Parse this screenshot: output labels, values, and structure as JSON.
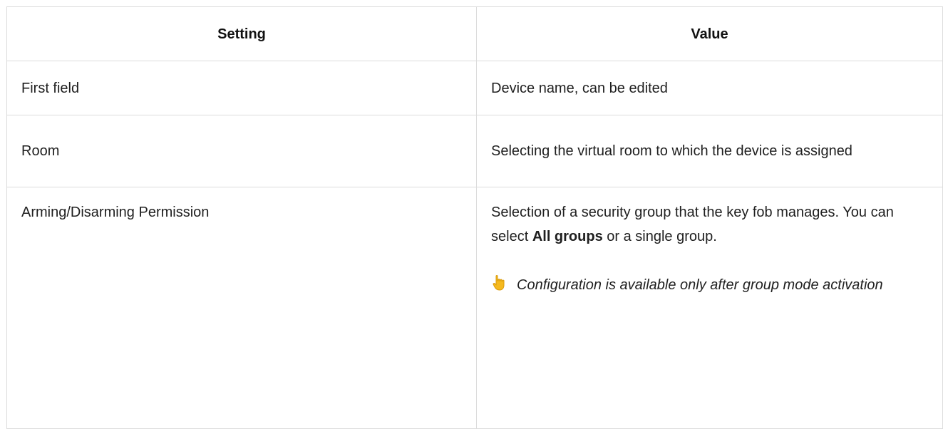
{
  "table": {
    "headers": {
      "setting": "Setting",
      "value": "Value"
    },
    "rows": [
      {
        "setting": "First field",
        "value": "Device name, can be edited"
      },
      {
        "setting": "Room",
        "value": "Selecting the virtual room to which the device is assigned"
      },
      {
        "setting": "Arming/Disarming Permission",
        "value_before_bold": "Selection of a security group that the key fob manages. You can select ",
        "value_bold": "All groups",
        "value_after_bold": " or a single group.",
        "note_icon": "pointing-hand-icon",
        "note": "Configuration is available only after group mode activation"
      }
    ]
  },
  "colors": {
    "border": "#dcdcdc",
    "text": "#1f1f1f",
    "hand_icon": "#f5b91e"
  }
}
